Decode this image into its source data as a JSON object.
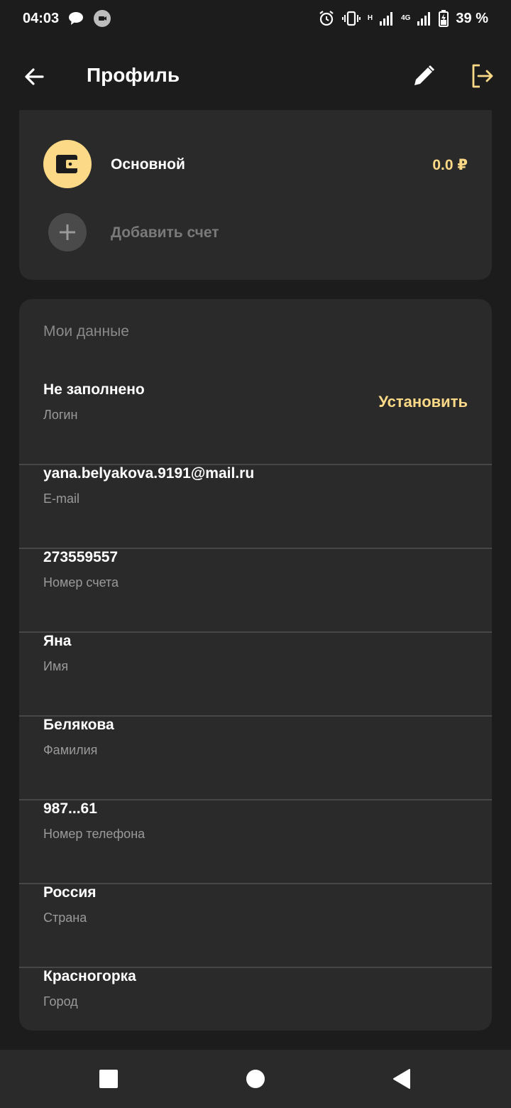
{
  "status_bar": {
    "time": "04:03",
    "net_label": "H",
    "net_label2": "4G",
    "battery": "39 %"
  },
  "header": {
    "title": "Профиль"
  },
  "accounts": {
    "main": {
      "name": "Основной",
      "balance": "0.0 ₽"
    },
    "add_label": "Добавить счет"
  },
  "my_data": {
    "title": "Мои данные",
    "set_label": "Установить",
    "fields": [
      {
        "value": "Не заполнено",
        "label": "Логин"
      },
      {
        "value": "yana.belyakova.9191@mail.ru",
        "label": "E-mail"
      },
      {
        "value": "273559557",
        "label": "Номер счета"
      },
      {
        "value": "Яна",
        "label": "Имя"
      },
      {
        "value": "Белякова",
        "label": "Фамилия"
      },
      {
        "value": "987...61",
        "label": "Номер телефона"
      },
      {
        "value": "Россия",
        "label": "Страна"
      },
      {
        "value": "Красногорка",
        "label": "Город"
      }
    ]
  },
  "colors": {
    "accent": "#fbd987",
    "background": "#1c1c1c",
    "card": "#2a2a2a"
  }
}
